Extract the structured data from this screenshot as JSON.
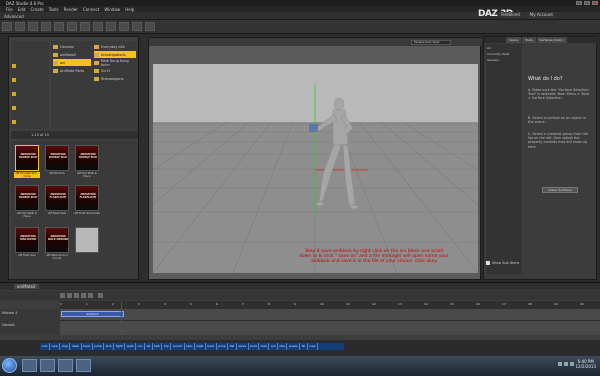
{
  "app": {
    "title": "DAZ Studio 4.6 Pro",
    "logo": "DAZ 3D",
    "menu": [
      "File",
      "Edit",
      "Create",
      "Tools",
      "Render",
      "Connect",
      "Window",
      "Help"
    ],
    "top_links": [
      "TeleBlend",
      "My Account"
    ],
    "layout_tab": "Advanced"
  },
  "content_library": {
    "tree_rows": [
      {
        "label": ""
      },
      {
        "label": ""
      },
      {
        "label": ""
      },
      {
        "label": ""
      },
      {
        "label": ""
      }
    ],
    "categories": [
      {
        "label": "Genesis",
        "selected": false
      },
      {
        "label": "aniMate2",
        "selected": false
      },
      {
        "label": "ani",
        "selected": true
      },
      {
        "label": "AniMate Parts",
        "selected": false
      },
      {
        "label": "Everyday Life",
        "selected": false
      },
      {
        "label": "Investigations",
        "selected": true
      },
      {
        "label": "Male Kung Kung Anim",
        "selected": false
      },
      {
        "label": "Sci-Fi",
        "selected": false
      },
      {
        "label": "Shenanigans",
        "selected": false
      }
    ],
    "page_info": "1-15 of 15",
    "thumbs": [
      {
        "title": "ANIMATION DOUBLE KICK",
        "label": "AM Dovetail Kick - Cycle",
        "selected": true
      },
      {
        "title": "ANIMATION DOUBLE KICK",
        "label": "AM Dbl Kick",
        "selected": false
      },
      {
        "title": "ANIMATION DOUBLE KICK",
        "label": "AM Ded Walk In Place",
        "selected": false
      },
      {
        "title": "ANIMATION DOUBLE KICK",
        "label": "AM Ded Walk In Place",
        "selected": false
      },
      {
        "title": "ANIMATION FLASHLIGHT",
        "label": "AM Flash Sam",
        "selected": false
      },
      {
        "title": "ANIMATION FLASHLIGHT",
        "label": "AM Flash Sam Knife",
        "selected": false
      },
      {
        "title": "ANIMATION MAN DOWN",
        "label": "AM Flash Gun",
        "selected": false
      },
      {
        "title": "ANIMATION WALK AROUND",
        "label": "AM Walk Around Corner",
        "selected": false
      },
      {
        "title": "",
        "label": "",
        "selected": false
      }
    ]
  },
  "viewport": {
    "camera": "Perspective View",
    "instruction": "Step 8 save aniblock by right click on the ani block and scroll down to & click \" save as\" and a file manager will open name your aniblock and save it in the file of your choice. click okay"
  },
  "right_panel": {
    "tabs": [
      "Scene",
      "Tools",
      "Surfaces (Color)"
    ],
    "scene_items": [
      "All",
      "Currently Used",
      "Genesis"
    ],
    "help_title": "What do I do?",
    "help_steps": [
      "A. Make sure the \"Surface Selection Tool\" is selected. Main Menu > Tools > Surface Selection",
      "B. Select a surface on an object in the scene.",
      "C. Select a material group from the list on the left, then adjust the property controls that will show up here."
    ],
    "help_button": "Video: Surfaces",
    "show_sub_items": "Show Sub Items"
  },
  "timeline": {
    "tab": "aniMate2",
    "ruler_ticks": [
      "0",
      "1",
      "2",
      "3",
      "4",
      "5",
      "6",
      "7",
      "8",
      "9",
      "10",
      "11",
      "12",
      "13",
      "14",
      "15",
      "16",
      "17",
      "18",
      "19",
      "20"
    ],
    "tracks": [
      "Michael 4",
      "Genesis"
    ],
    "aniblock_label": "aniblock"
  },
  "tag_strip": [
    "cow",
    "new",
    "clap",
    "dash",
    "hack",
    "jump",
    "kick",
    "fight",
    "walk",
    "run",
    "sit",
    "talk",
    "trip",
    "punch",
    "spin",
    "walk",
    "bent",
    "jump",
    "fall",
    "wave",
    "hold",
    "look",
    "ani",
    "idle",
    "poses",
    "tkl",
    "new"
  ],
  "taskbar": {
    "clock_time": "6:40 PM",
    "clock_date": "12/2/2013"
  }
}
